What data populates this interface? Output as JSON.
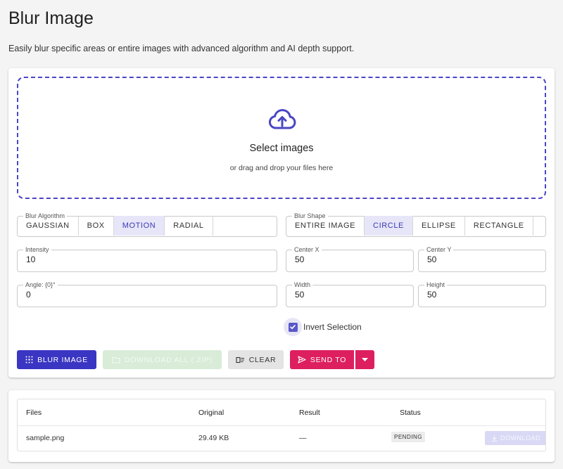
{
  "page": {
    "title": "Blur Image",
    "subtitle": "Easily blur specific areas or entire images with advanced algorithm and AI depth support."
  },
  "dropzone": {
    "title": "Select images",
    "subtitle": "or drag and drop your files here",
    "icon": "cloud-upload-icon"
  },
  "algorithm": {
    "legend": "Blur Algorithm",
    "options": [
      "GAUSSIAN",
      "BOX",
      "MOTION",
      "RADIAL"
    ],
    "selected": "MOTION"
  },
  "shape": {
    "legend": "Blur Shape",
    "options": [
      "ENTIRE IMAGE",
      "CIRCLE",
      "ELLIPSE",
      "RECTANGLE"
    ],
    "selected": "CIRCLE"
  },
  "fields": {
    "intensity": {
      "label": "Intensity",
      "value": "10"
    },
    "center_x": {
      "label": "Center X",
      "value": "50"
    },
    "center_y": {
      "label": "Center Y",
      "value": "50"
    },
    "angle": {
      "label": "Angle: {0}°",
      "value": "0"
    },
    "width": {
      "label": "Width",
      "value": "50"
    },
    "height": {
      "label": "Height",
      "value": "50"
    }
  },
  "invert": {
    "label": "Invert Selection",
    "checked": true
  },
  "actions": {
    "blur": "BLUR IMAGE",
    "download_all": "DOWNLOAD ALL (.ZIP)",
    "clear": "CLEAR",
    "send_to": "SEND TO"
  },
  "table": {
    "headers": [
      "Files",
      "Original",
      "Result",
      "Status"
    ],
    "rows": [
      {
        "file": "sample.png",
        "original": "29.49 KB",
        "result": "—",
        "status": "PENDING",
        "action": "DOWNLOAD"
      }
    ]
  },
  "colors": {
    "primary": "#3a35c2",
    "accent": "#dd1f5f",
    "selected_segment": "#e6e6f8"
  }
}
